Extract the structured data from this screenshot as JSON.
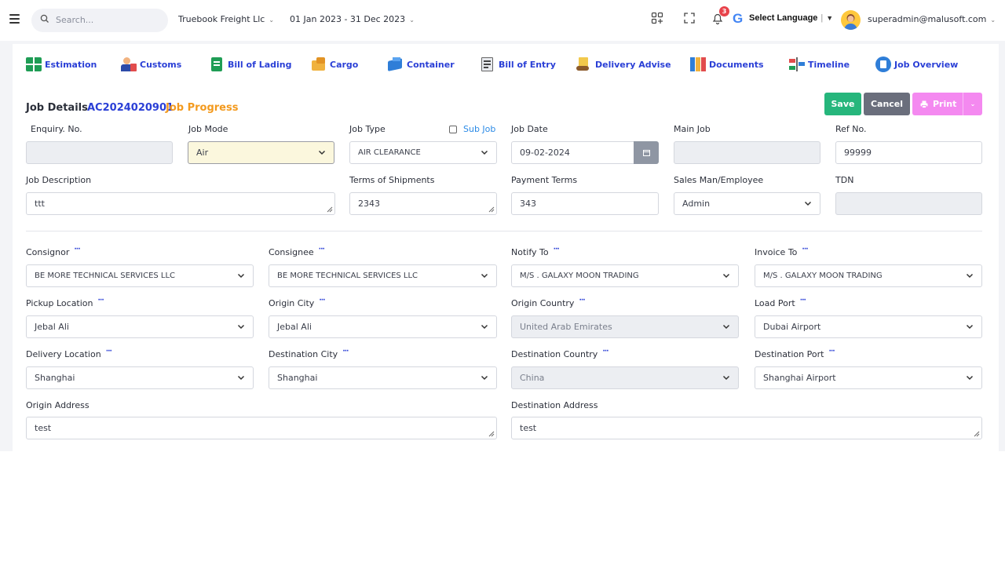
{
  "topbar": {
    "search_placeholder": "Search...",
    "company": "Truebook Freight Llc",
    "period": "01 Jan 2023 - 31 Dec 2023",
    "notifications_count": "3",
    "language_label": "Select Language",
    "language_sep": "|",
    "language_caret": "▼",
    "user_email": "superadmin@malusoft.com",
    "google_letter": "G"
  },
  "tabs": [
    {
      "label": "Estimation",
      "icon": "estimation-icon"
    },
    {
      "label": "Customs",
      "icon": "customs-icon"
    },
    {
      "label": "Bill of Lading",
      "icon": "bill-of-lading-icon"
    },
    {
      "label": "Cargo",
      "icon": "cargo-icon"
    },
    {
      "label": "Container",
      "icon": "container-icon"
    },
    {
      "label": "Bill of Entry",
      "icon": "bill-of-entry-icon"
    },
    {
      "label": "Delivery Advise",
      "icon": "delivery-advise-icon"
    },
    {
      "label": "Documents",
      "icon": "documents-icon"
    },
    {
      "label": "Timeline",
      "icon": "timeline-icon"
    },
    {
      "label": "Job Overview",
      "icon": "job-overview-icon"
    }
  ],
  "header": {
    "title": "Job Details",
    "job_number": "AC2024020901",
    "progress": "Job Progress",
    "save": "Save",
    "cancel": "Cancel",
    "print": "Print"
  },
  "form": {
    "enquiry_no": {
      "label": "Enquiry. No.",
      "value": ""
    },
    "job_mode": {
      "label": "Job Mode",
      "value": "Air"
    },
    "job_type": {
      "label": "Job Type",
      "value": "AIR CLEARANCE"
    },
    "sub_job": {
      "label": "Sub Job",
      "checked": false
    },
    "job_date": {
      "label": "Job Date",
      "value": "09-02-2024"
    },
    "main_job": {
      "label": "Main Job",
      "value": ""
    },
    "ref_no": {
      "label": "Ref No.",
      "value": "99999"
    },
    "job_description": {
      "label": "Job Description",
      "value": "ttt"
    },
    "terms_of_shipments": {
      "label": "Terms of Shipments",
      "value": "2343"
    },
    "payment_terms": {
      "label": "Payment Terms",
      "value": "343"
    },
    "sales_man": {
      "label": "Sales Man/Employee",
      "value": "Admin"
    },
    "tdn": {
      "label": "TDN",
      "value": ""
    },
    "consignor": {
      "label": "Consignor",
      "value": "BE MORE TECHNICAL SERVICES LLC"
    },
    "consignee": {
      "label": "Consignee",
      "value": "BE MORE TECHNICAL SERVICES LLC"
    },
    "notify_to": {
      "label": "Notify To",
      "value": "M/S . GALAXY MOON TRADING"
    },
    "invoice_to": {
      "label": "Invoice To",
      "value": "M/S . GALAXY MOON TRADING"
    },
    "pickup_location": {
      "label": "Pickup Location",
      "value": "Jebal Ali"
    },
    "origin_city": {
      "label": "Origin City",
      "value": "Jebal Ali"
    },
    "origin_country": {
      "label": "Origin Country",
      "value": "United Arab Emirates"
    },
    "load_port": {
      "label": "Load Port",
      "value": "Dubai Airport"
    },
    "delivery_location": {
      "label": "Delivery Location",
      "value": "Shanghai"
    },
    "destination_city": {
      "label": "Destination City",
      "value": "Shanghai"
    },
    "destination_country": {
      "label": "Destination Country",
      "value": "China"
    },
    "destination_port": {
      "label": "Destination Port",
      "value": "Shanghai Airport"
    },
    "origin_address": {
      "label": "Origin Address",
      "value": "test"
    },
    "destination_address": {
      "label": "Destination Address",
      "value": "test"
    },
    "more_dots": "···"
  },
  "colors": {
    "accent_blue": "#2a3fd6",
    "progress_orange": "#f39a1e",
    "save_green": "#26b67c",
    "cancel_gray": "#6a6e7c",
    "print_pink": "#f489f0"
  }
}
